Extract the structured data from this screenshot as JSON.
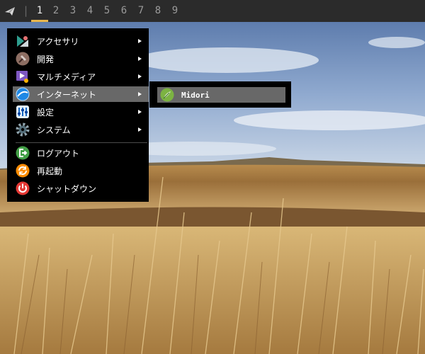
{
  "panel": {
    "launcher_icon": "paper-plane-icon",
    "separator": "|",
    "workspaces": [
      "1",
      "2",
      "3",
      "4",
      "5",
      "6",
      "7",
      "8",
      "9"
    ],
    "active_workspace": "1",
    "accent_color": "#e8b64c"
  },
  "menu": {
    "items": [
      {
        "label": "アクセサリ",
        "icon": "accessories-icon",
        "submenu": true
      },
      {
        "label": "開発",
        "icon": "hammer-icon",
        "submenu": true
      },
      {
        "label": "マルチメディア",
        "icon": "multimedia-icon",
        "submenu": true
      },
      {
        "label": "インターネット",
        "icon": "internet-icon",
        "submenu": true,
        "highlighted": true
      },
      {
        "label": "設定",
        "icon": "settings-icon",
        "submenu": true
      },
      {
        "label": "システム",
        "icon": "system-gear-icon",
        "submenu": true
      }
    ],
    "actions": [
      {
        "label": "ログアウト",
        "icon": "logout-icon"
      },
      {
        "label": "再起動",
        "icon": "reboot-icon"
      },
      {
        "label": "シャットダウン",
        "icon": "power-icon"
      }
    ]
  },
  "submenu": {
    "items": [
      {
        "label": "Midori",
        "icon": "midori-browser-icon",
        "highlighted": true
      }
    ]
  },
  "colors": {
    "menu_bg": "#000000",
    "highlight_bg": "#686868"
  }
}
